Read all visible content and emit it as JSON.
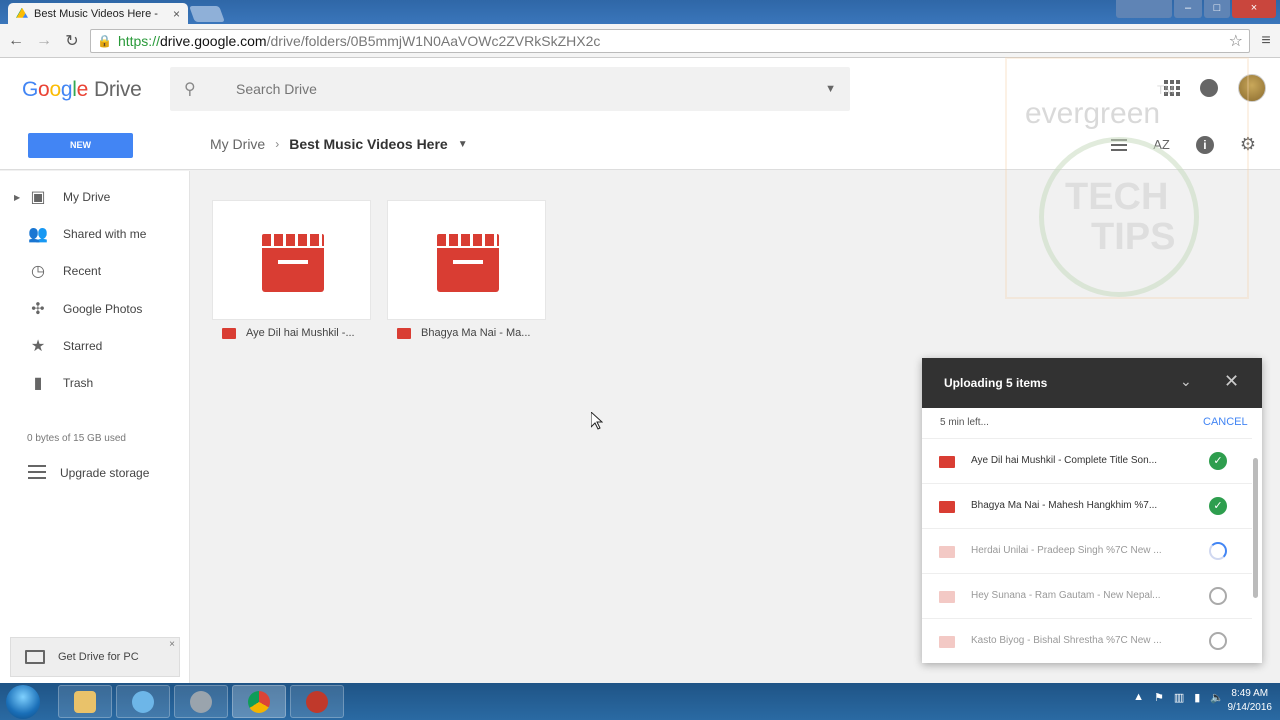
{
  "browser": {
    "tab_title": "Best Music Videos Here -",
    "url_scheme": "https://",
    "url_host": "drive.google.com",
    "url_path": "/drive/folders/0B5mmjW1N0AaVOWc2ZVRkSkZHX2c"
  },
  "header": {
    "logo_letters": [
      "G",
      "o",
      "o",
      "g",
      "l",
      "e"
    ],
    "logo_product": "Drive",
    "search_placeholder": "Search Drive"
  },
  "subheader": {
    "new_label": "NEW",
    "breadcrumb_root": "My Drive",
    "breadcrumb_current": "Best Music Videos Here",
    "sort_label": "AZ"
  },
  "sidebar": {
    "items": [
      {
        "label": "My Drive",
        "icon": "drive-icon"
      },
      {
        "label": "Shared with me",
        "icon": "people-icon"
      },
      {
        "label": "Recent",
        "icon": "clock-icon"
      },
      {
        "label": "Google Photos",
        "icon": "pinwheel-icon"
      },
      {
        "label": "Starred",
        "icon": "star-icon"
      },
      {
        "label": "Trash",
        "icon": "trash-icon"
      }
    ],
    "storage_text": "0 bytes of 15 GB used",
    "upgrade_label": "Upgrade storage",
    "get_drive_label": "Get Drive for PC"
  },
  "files": [
    {
      "name": "Aye Dil hai Mushkil -..."
    },
    {
      "name": "Bhagya Ma Nai - Ma..."
    }
  ],
  "watermark": {
    "line1": "evergreen",
    "line2": "TECH",
    "line3": "TIPS",
    "mark": "TM"
  },
  "upload": {
    "title": "Uploading 5 items",
    "time_left": "5 min left...",
    "cancel_label": "CANCEL",
    "items": [
      {
        "name": "Aye Dil hai Mushkil - Complete Title Son...",
        "status": "done"
      },
      {
        "name": "Bhagya Ma Nai - Mahesh Hangkhim %7...",
        "status": "done"
      },
      {
        "name": "Herdai Unilai - Pradeep Singh %7C New ...",
        "status": "uploading"
      },
      {
        "name": "Hey Sunana - Ram Gautam - New Nepal...",
        "status": "pending"
      },
      {
        "name": "Kasto Biyog - Bishal Shrestha %7C New ...",
        "status": "pending"
      }
    ]
  },
  "taskbar": {
    "time": "8:49 AM",
    "date": "9/14/2016"
  },
  "colors": {
    "accent_blue": "#4285f4",
    "file_red": "#d93d33",
    "success_green": "#2e9e4e",
    "panel_dark": "#323232"
  }
}
